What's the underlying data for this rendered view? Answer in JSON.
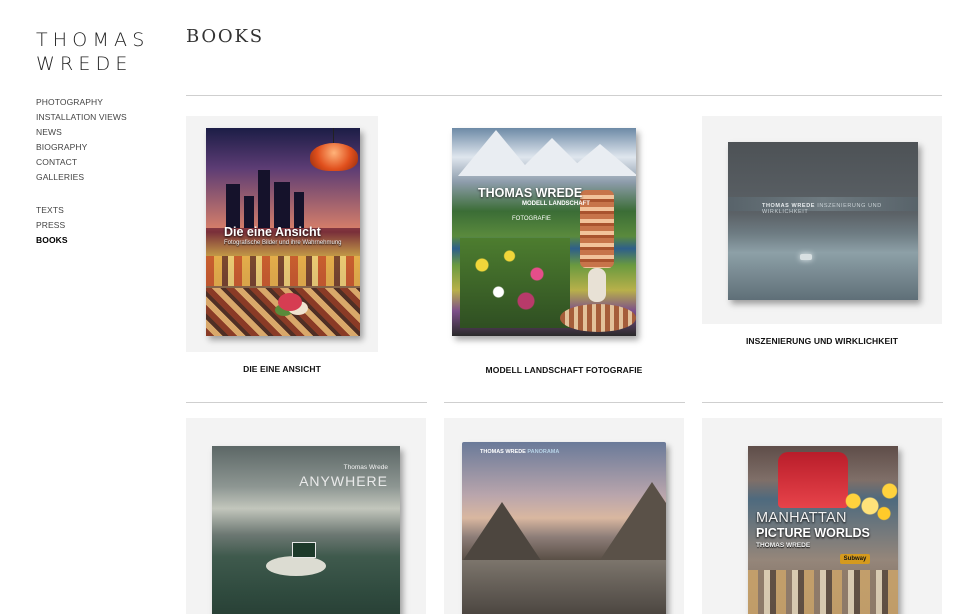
{
  "site": {
    "logo_line1": "THOMAS",
    "logo_line2": "WREDE"
  },
  "nav": {
    "primary": [
      "PHOTOGRAPHY",
      "INSTALLATION VIEWS",
      "NEWS",
      "BIOGRAPHY",
      "CONTACT",
      "GALLERIES"
    ],
    "secondary": [
      "TEXTS",
      "PRESS",
      "BOOKS"
    ],
    "active": "BOOKS"
  },
  "page": {
    "title": "BOOKS"
  },
  "books": [
    {
      "caption": "DIE EINE ANSICHT",
      "cover_title": "Die eine Ansicht",
      "cover_subtitle": "Fotografische Bilder und ihre Wahrnehmung"
    },
    {
      "caption": "MODELL LANDSCHAFT FOTOGRAFIE",
      "cover_title": "THOMAS WREDE",
      "cover_subtitle": "MODELL LANDSCHAFT",
      "cover_subtitle2": "FOTOGRAFIE"
    },
    {
      "caption": "INSZENIERUNG UND WIRKLICHKEIT",
      "cover_author": "THOMAS WREDE",
      "cover_title": "INSZENIERUNG UND WIRKLICHKEIT"
    },
    {
      "caption": "",
      "cover_author": "Thomas Wrede",
      "cover_title": "ANYWHERE"
    },
    {
      "caption": "",
      "cover_author": "THOMAS WREDE",
      "cover_title": "PANORAMA"
    },
    {
      "caption": "",
      "cover_title": "MANHATTAN",
      "cover_title2": "PICTURE WORLDS",
      "cover_author": "THOMAS WREDE",
      "cover_sign": "Subway"
    }
  ]
}
